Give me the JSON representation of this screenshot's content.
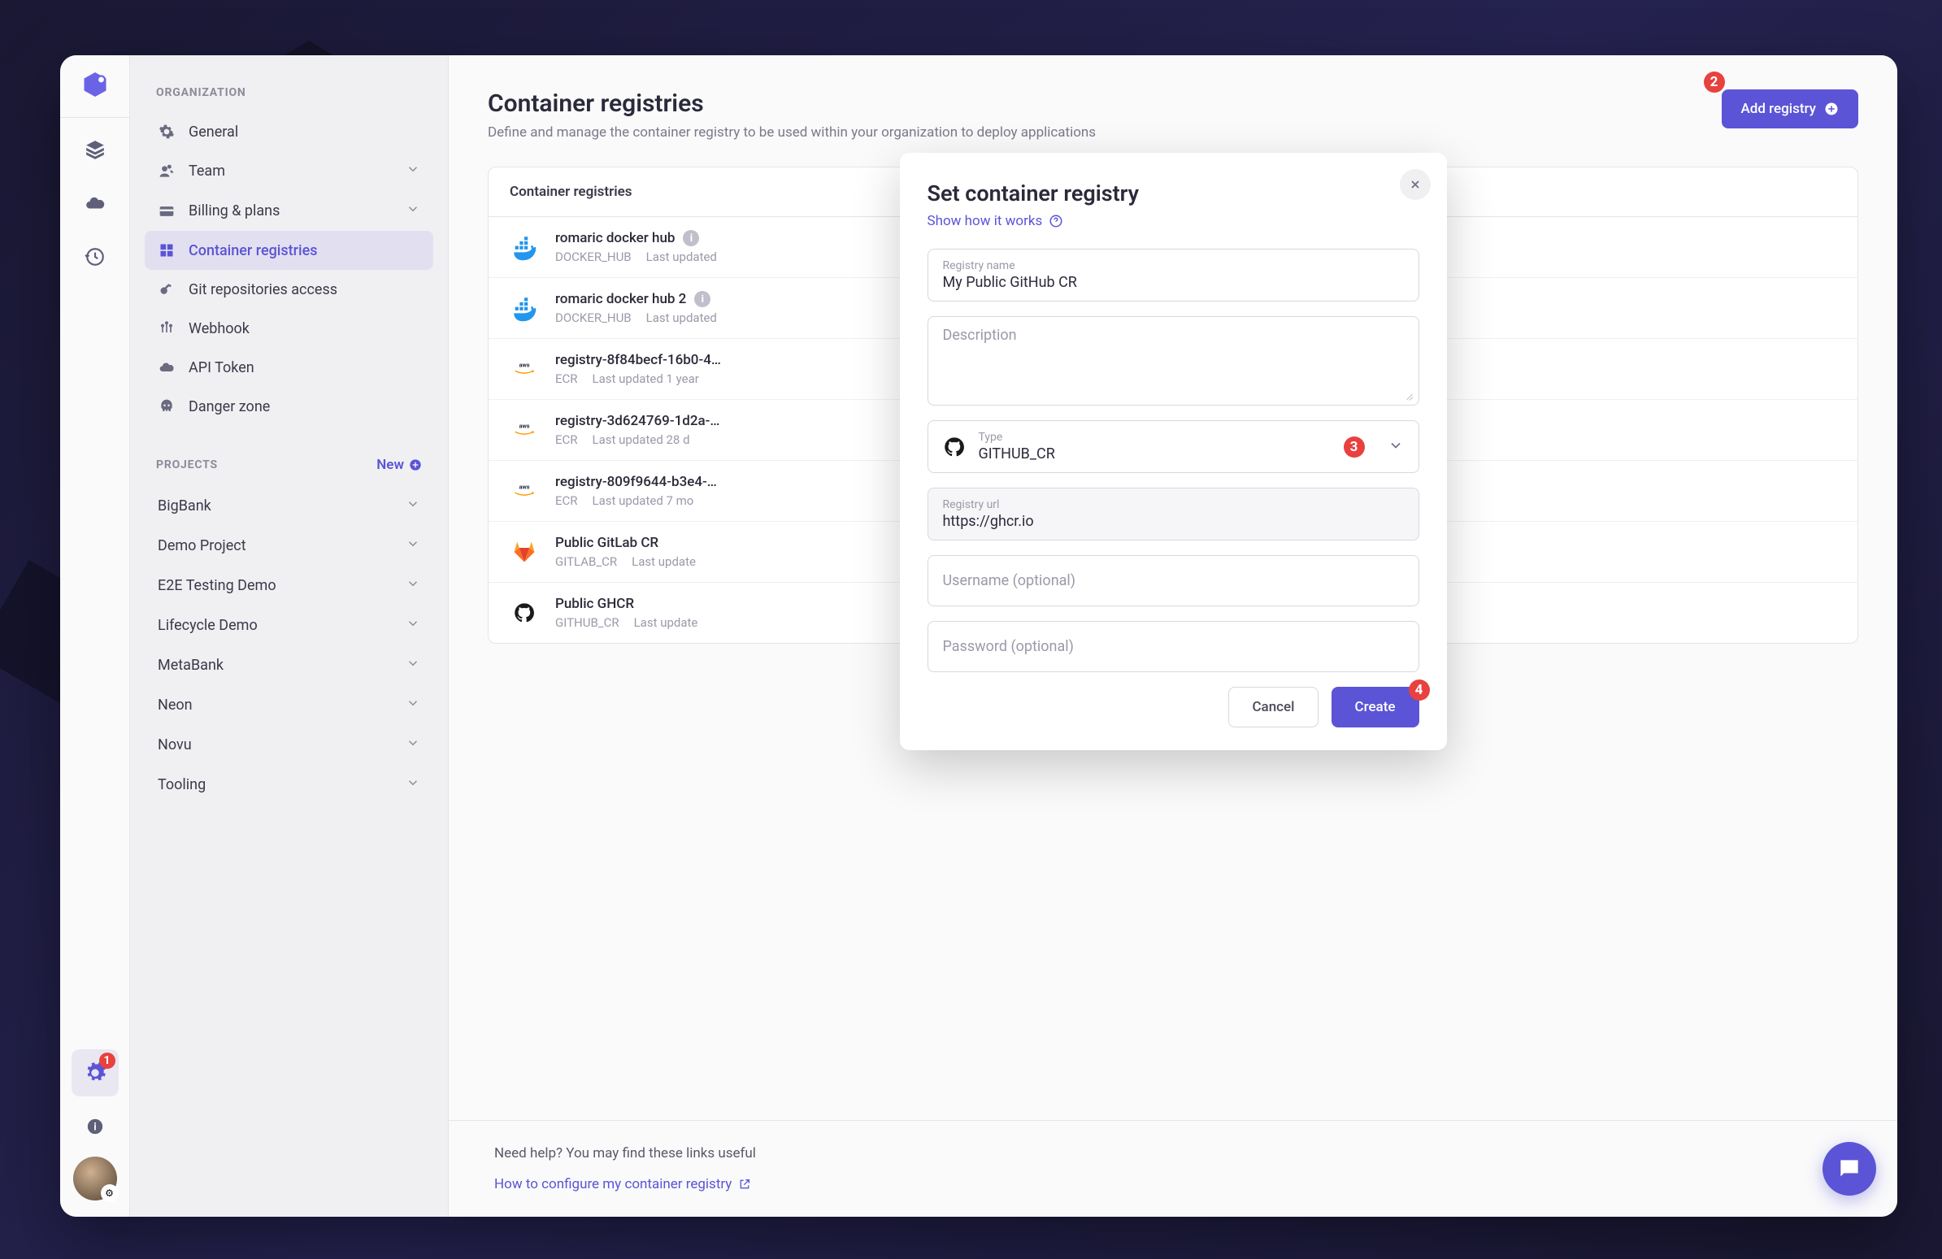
{
  "sidebar": {
    "org_label": "ORGANIZATION",
    "projects_label": "PROJECTS",
    "new_label": "New",
    "items": [
      {
        "icon": "gear",
        "label": "General"
      },
      {
        "icon": "team",
        "label": "Team",
        "chevron": true
      },
      {
        "icon": "card",
        "label": "Billing & plans",
        "chevron": true
      },
      {
        "icon": "registry",
        "label": "Container registries",
        "active": true
      },
      {
        "icon": "key",
        "label": "Git repositories access"
      },
      {
        "icon": "webhook",
        "label": "Webhook"
      },
      {
        "icon": "cloud",
        "label": "API Token"
      },
      {
        "icon": "skull",
        "label": "Danger zone"
      }
    ],
    "projects": [
      {
        "label": "BigBank"
      },
      {
        "label": "Demo Project"
      },
      {
        "label": "E2E Testing Demo"
      },
      {
        "label": "Lifecycle Demo"
      },
      {
        "label": "MetaBank"
      },
      {
        "label": "Neon"
      },
      {
        "label": "Novu"
      },
      {
        "label": "Tooling"
      }
    ]
  },
  "rail": {
    "settings_badge": "1"
  },
  "page": {
    "title": "Container registries",
    "subtitle": "Define and manage the container registry to be used within your organization to deploy applications",
    "add_button": "Add registry",
    "add_badge": "2",
    "table_header": "Container registries",
    "footer_text": "Need help? You may find these links useful",
    "footer_link": "How to configure my container registry"
  },
  "registries": [
    {
      "icon": "docker",
      "name": "romaric docker hub",
      "info": true,
      "type": "DOCKER_HUB",
      "updated": "Last updated"
    },
    {
      "icon": "docker",
      "name": "romaric docker hub 2",
      "info": true,
      "type": "DOCKER_HUB",
      "updated": "Last updated"
    },
    {
      "icon": "aws",
      "name": "registry-8f84becf-16b0-4…",
      "type": "ECR",
      "updated": "Last updated 1 year"
    },
    {
      "icon": "aws",
      "name": "registry-3d624769-1d2a-…",
      "type": "ECR",
      "updated": "Last updated 28 d"
    },
    {
      "icon": "aws",
      "name": "registry-809f9644-b3e4-…",
      "type": "ECR",
      "updated": "Last updated 7 mo"
    },
    {
      "icon": "gitlab",
      "name": "Public GitLab CR",
      "type": "GITLAB_CR",
      "updated": "Last update"
    },
    {
      "icon": "github",
      "name": "Public GHCR",
      "type": "GITHUB_CR",
      "updated": "Last update"
    }
  ],
  "modal": {
    "title": "Set container registry",
    "link": "Show how it works",
    "name_label": "Registry name",
    "name_value": "My Public GitHub CR",
    "desc_placeholder": "Description",
    "type_label": "Type",
    "type_value": "GITHUB_CR",
    "type_badge": "3",
    "url_label": "Registry url",
    "url_value": "https://ghcr.io",
    "username_placeholder": "Username (optional)",
    "password_placeholder": "Password (optional)",
    "cancel": "Cancel",
    "create": "Create",
    "create_badge": "4"
  }
}
